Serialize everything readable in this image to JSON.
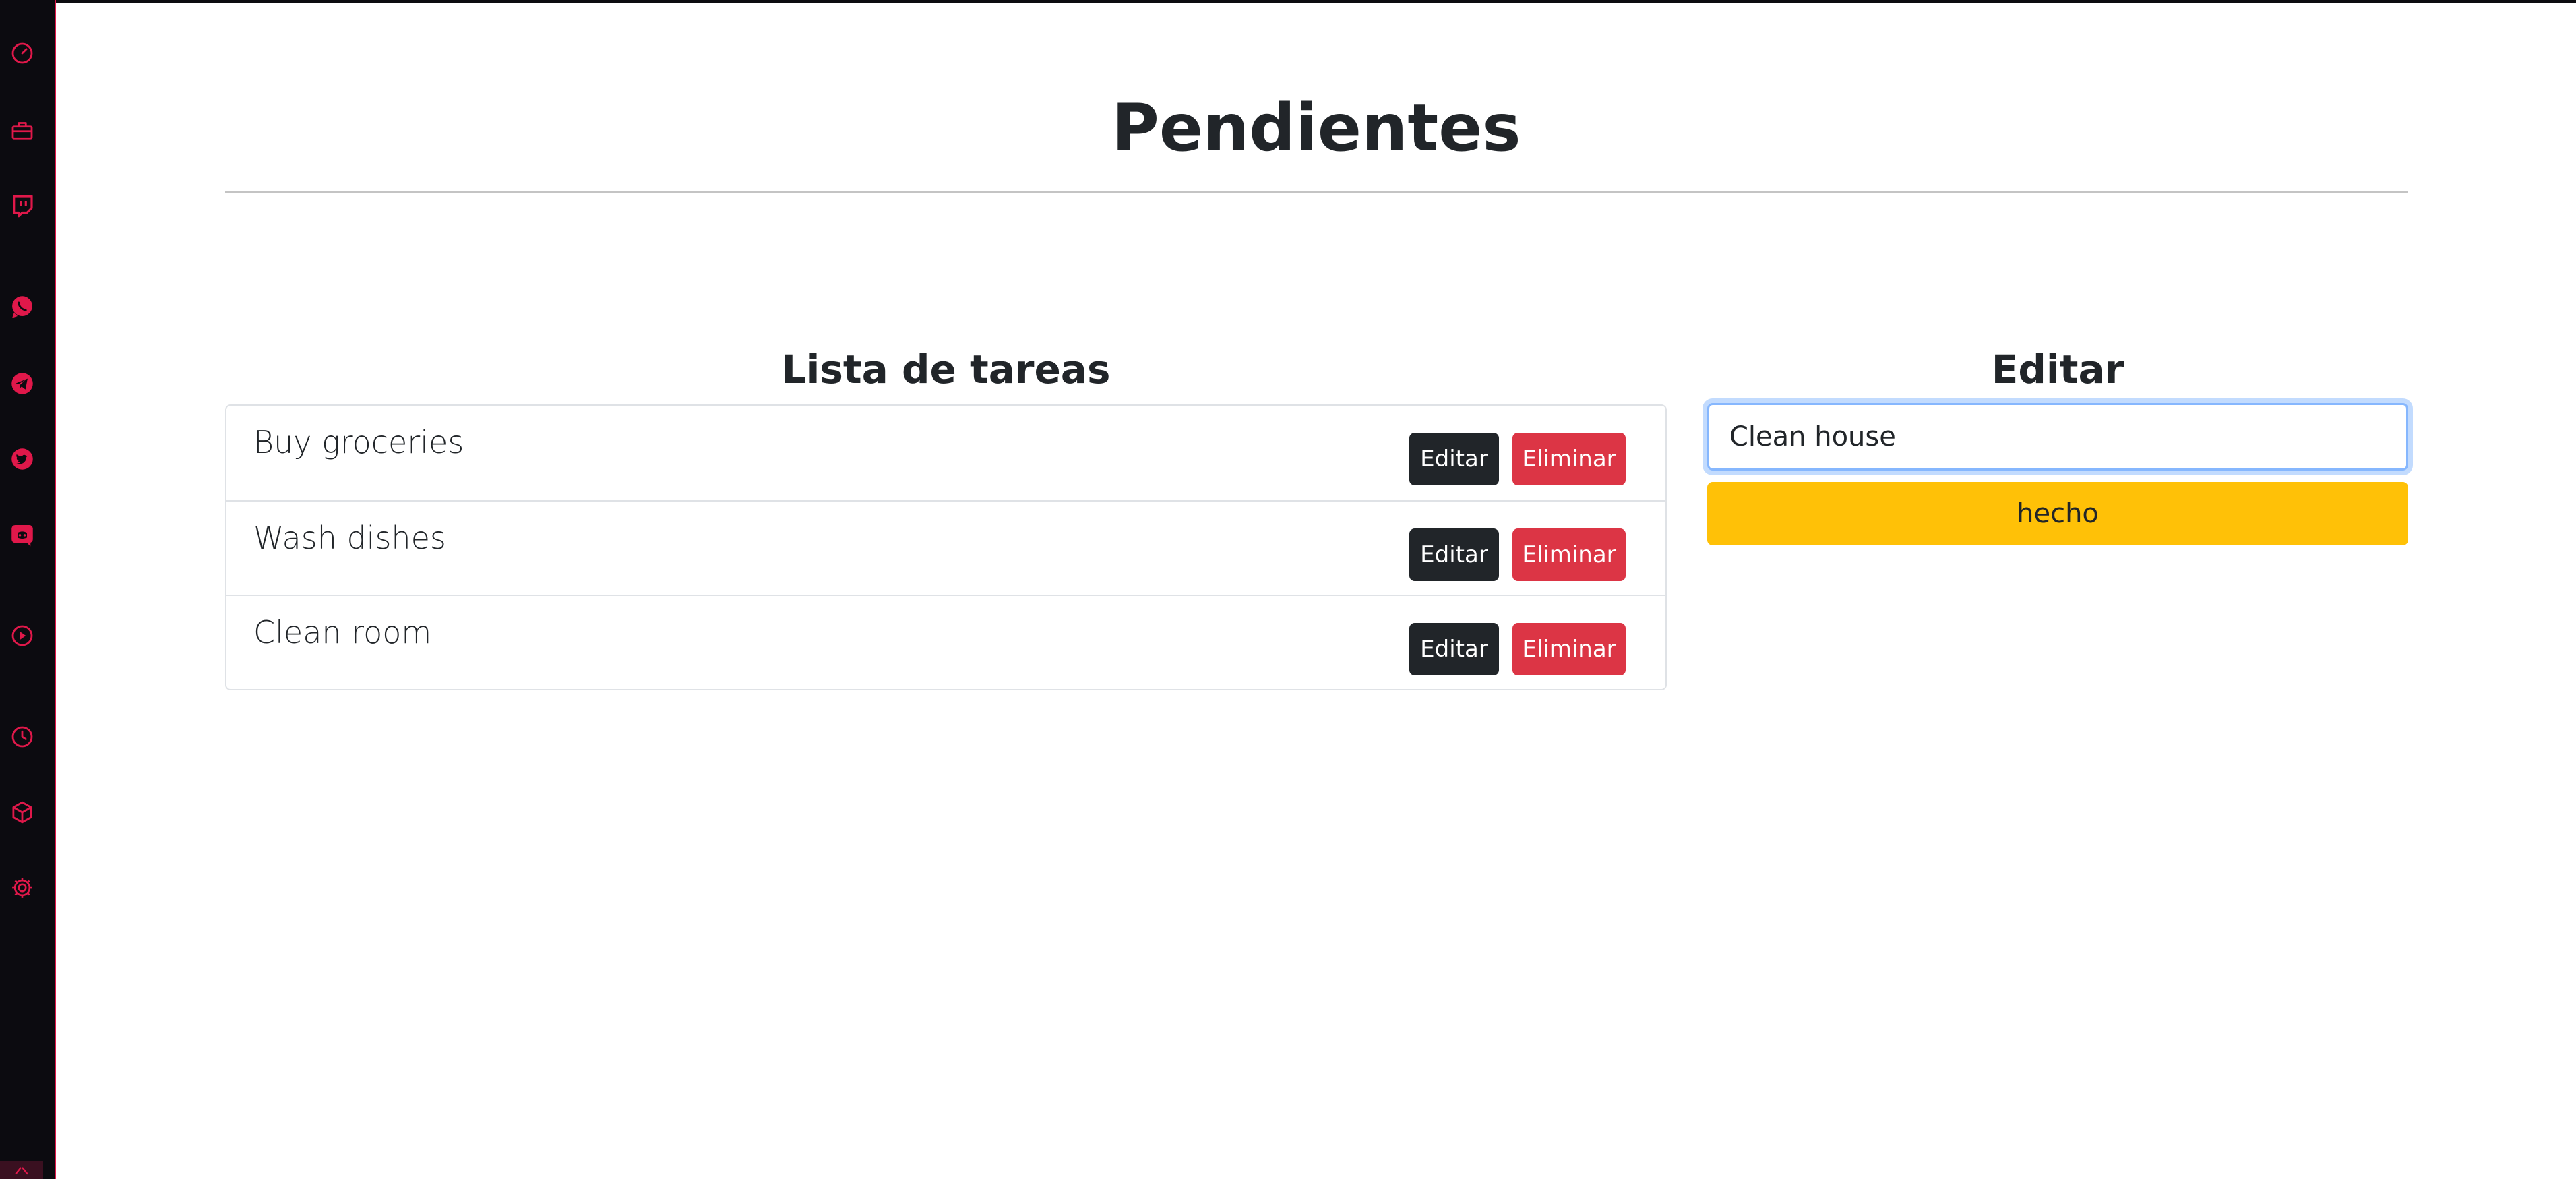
{
  "app": {
    "title": "Pendientes"
  },
  "sidebar": {
    "accent_color": "#e0184a",
    "background_color": "#0c0b10",
    "icons": [
      "speedometer-icon",
      "toolbox-icon",
      "twitch-icon",
      "whatsapp-icon",
      "telegram-icon",
      "twitter-icon",
      "discord-icon",
      "play-icon",
      "clock-icon",
      "cube-icon",
      "gear-icon",
      "expand-icon"
    ]
  },
  "list": {
    "heading": "Lista de tareas",
    "edit_label": "Editar",
    "delete_label": "Eliminar",
    "items": [
      {
        "text": "Buy groceries"
      },
      {
        "text": "Wash dishes"
      },
      {
        "text": "Clean room"
      }
    ]
  },
  "editor": {
    "heading": "Editar",
    "input_value": "Clean house",
    "submit_label": "hecho"
  },
  "colors": {
    "edit_button": "#212529",
    "delete_button": "#dc3545",
    "done_button": "#ffc107",
    "input_focus": "#86b7fe"
  }
}
